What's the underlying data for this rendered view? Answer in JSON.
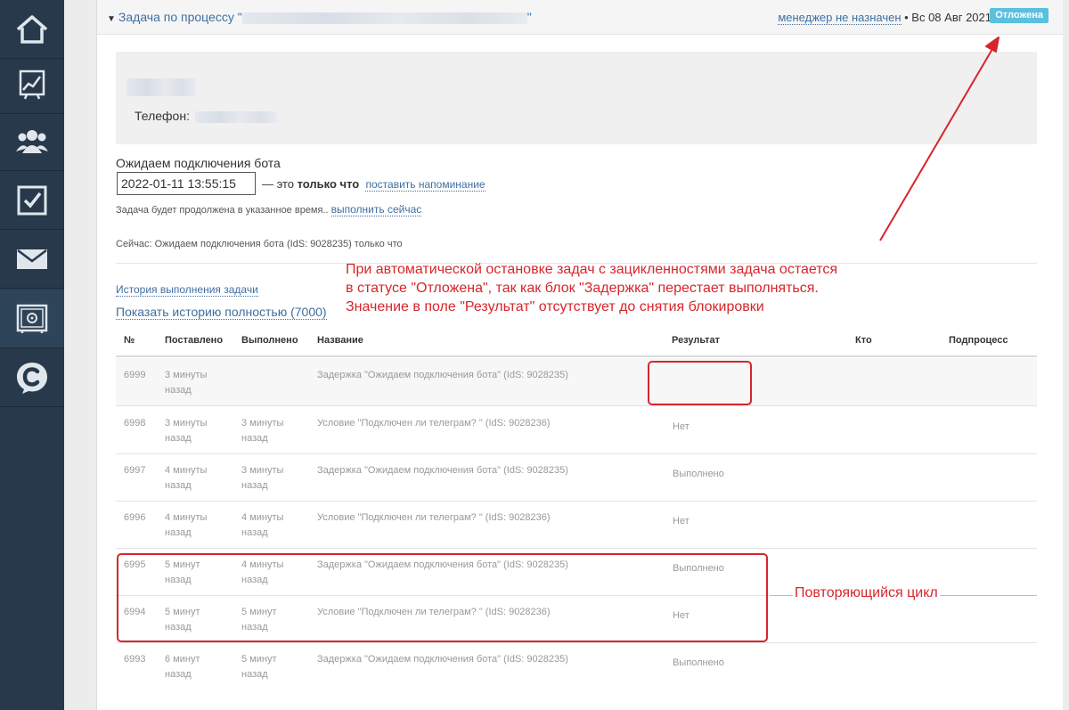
{
  "sidebar": {
    "items": [
      {
        "icon": "home-icon"
      },
      {
        "icon": "chart-icon"
      },
      {
        "icon": "users-icon"
      },
      {
        "icon": "checkbox-icon"
      },
      {
        "icon": "mail-icon"
      },
      {
        "icon": "safe-icon"
      },
      {
        "icon": "c-logo-icon"
      }
    ]
  },
  "header": {
    "toggle_prefix": "Задача по процессу \"",
    "toggle_suffix": "\"",
    "manager_link": "менеджер не назначен",
    "date_text": " • Вс 08 Авг 2021",
    "status_badge": "Отложена"
  },
  "contact": {
    "phone_label": "Телефон:"
  },
  "wait": {
    "title": "Ожидаем подключения бота",
    "datetime_value": "2022-01-11 13:55:15",
    "note_prefix": "— это ",
    "note_bold": "только что",
    "reminder_link": "поставить напоминание",
    "resume_text": "Задача будет продолжена в указанное время.. ",
    "run_now_link": "выполнить сейчас",
    "now_status": "Сейчас: Ожидаем подключения бота (IdS: 9028235) только что"
  },
  "history": {
    "link_label": "История выполнения задачи",
    "full_link_label": "Показать историю полностью (7000)"
  },
  "table": {
    "headers": {
      "num": "№",
      "set": "Поставлено",
      "done": "Выполнено",
      "name": "Название",
      "result": "Результат",
      "who": "Кто",
      "subprocess": "Подпроцесс"
    },
    "rows": [
      {
        "num": "6999",
        "set": "3 минуты назад",
        "done": "",
        "name": "Задержка \"Ожидаем подключения бота\" (IdS: 9028235)",
        "result": ""
      },
      {
        "num": "6998",
        "set": "3 минуты назад",
        "done": "3 минуты назад",
        "name": "Условие \"Подключен ли телеграм? \" (IdS: 9028236)",
        "result": "Нет"
      },
      {
        "num": "6997",
        "set": "4 минуты назад",
        "done": "3 минуты назад",
        "name": "Задержка \"Ожидаем подключения бота\" (IdS: 9028235)",
        "result": "Выполнено"
      },
      {
        "num": "6996",
        "set": "4 минуты назад",
        "done": "4 минуты назад",
        "name": "Условие \"Подключен ли телеграм? \" (IdS: 9028236)",
        "result": "Нет"
      },
      {
        "num": "6995",
        "set": "5 минут назад",
        "done": "4 минуты назад",
        "name": "Задержка \"Ожидаем подключения бота\" (IdS: 9028235)",
        "result": "Выполнено"
      },
      {
        "num": "6994",
        "set": "5 минут назад",
        "done": "5 минут назад",
        "name": "Условие \"Подключен ли телеграм? \" (IdS: 9028236)",
        "result": "Нет"
      },
      {
        "num": "6993",
        "set": "6 минут назад",
        "done": "5 минут назад",
        "name": "Задержка \"Ожидаем подключения бота\" (IdS: 9028235)",
        "result": "Выполнено"
      }
    ]
  },
  "annotations": {
    "note_lines": [
      "При автоматической остановке задач с зацикленностями задача остается",
      "в статусе \"Отложена\", так как блок \"Задержка\" перестает выполняться.",
      "Значение в поле \"Результат\" отсутствует до снятия блокировки"
    ],
    "cycle_label": "Повторяющийся цикл",
    "accent_color": "#d6262b"
  },
  "colors": {
    "sidebar_bg": "#27394a",
    "link": "#3f6fa0",
    "badge_bg": "#5bc0de"
  }
}
